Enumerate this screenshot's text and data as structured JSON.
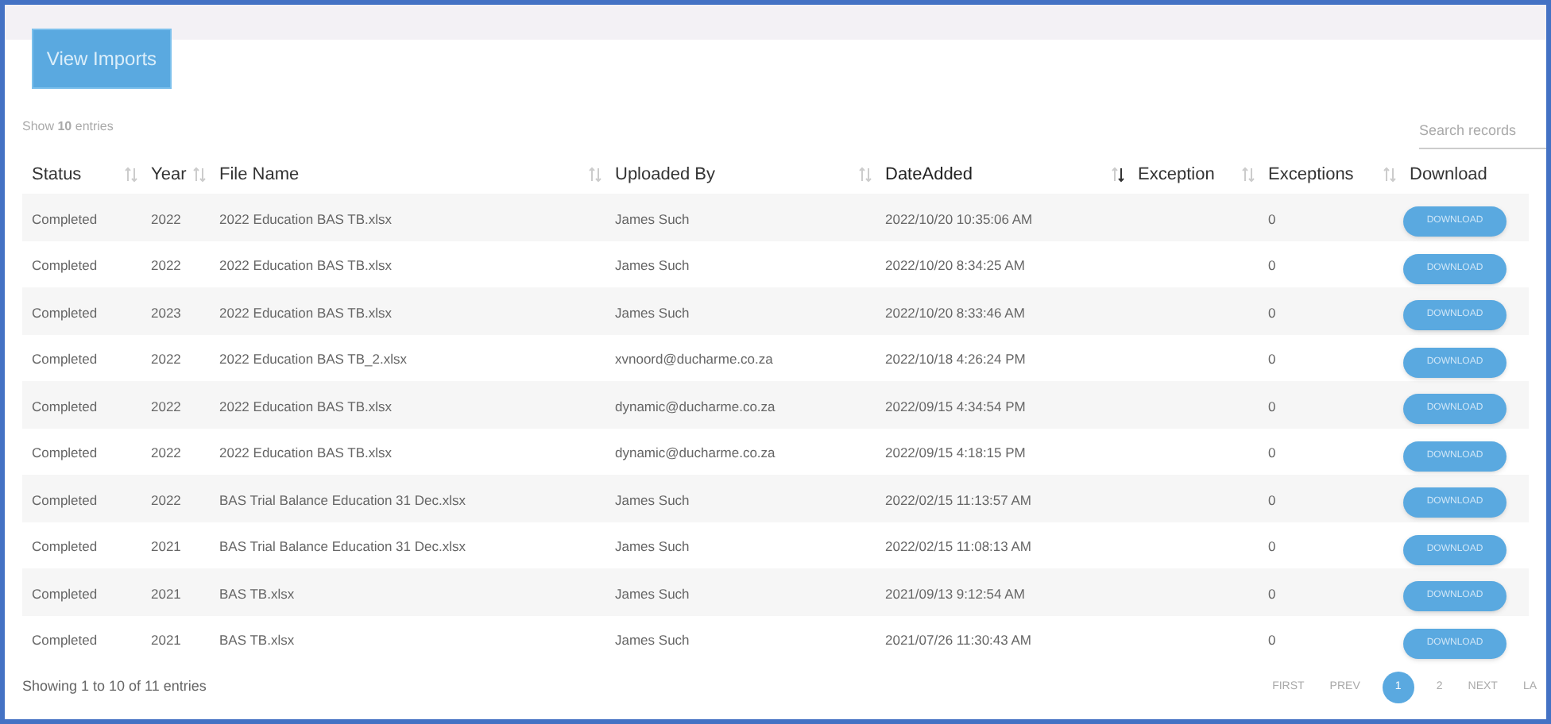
{
  "toolbar": {
    "button": "View Imports"
  },
  "length_info": "Show **10** entries",
  "search": {
    "placeholder": "Search records"
  },
  "table": {
    "columns": [
      {
        "label": "Status",
        "sortable": true,
        "sorted": false
      },
      {
        "label": "Year",
        "sortable": true,
        "sorted": false
      },
      {
        "label": "File Name",
        "sortable": true,
        "sorted": false
      },
      {
        "label": "Uploaded By",
        "sortable": true,
        "sorted": false
      },
      {
        "label": "DateAdded",
        "sortable": true,
        "sorted": true
      },
      {
        "label": "Exception",
        "sortable": true,
        "sorted": false
      },
      {
        "label": "Exceptions",
        "sortable": true,
        "sorted": false
      },
      {
        "label": "Download",
        "sortable": false
      }
    ],
    "rows": [
      {
        "status": "Completed",
        "year": "2022",
        "file": "2022 Education BAS TB.xlsx",
        "by": "James Such",
        "date": "2022/10/20 10:35:06 AM",
        "exceptions": "0",
        "action": "DOWNLOAD"
      },
      {
        "status": "Completed",
        "year": "2022",
        "file": "2022 Education BAS TB.xlsx",
        "by": "James Such",
        "date": "2022/10/20 8:34:25 AM",
        "exceptions": "0",
        "action": "DOWNLOAD"
      },
      {
        "status": "Completed",
        "year": "2023",
        "file": "2022 Education BAS TB.xlsx",
        "by": "James Such",
        "date": "2022/10/20 8:33:46 AM",
        "exceptions": "0",
        "action": "DOWNLOAD"
      },
      {
        "status": "Completed",
        "year": "2022",
        "file": "2022 Education BAS TB_2.xlsx",
        "by": "xvnoord@ducharme.co.za",
        "date": "2022/10/18 4:26:24 PM",
        "exceptions": "0",
        "action": "DOWNLOAD"
      },
      {
        "status": "Completed",
        "year": "2022",
        "file": "2022 Education BAS TB.xlsx",
        "by": "dynamic@ducharme.co.za",
        "date": "2022/09/15 4:34:54 PM",
        "exceptions": "0",
        "action": "DOWNLOAD"
      },
      {
        "status": "Completed",
        "year": "2022",
        "file": "2022 Education BAS TB.xlsx",
        "by": "dynamic@ducharme.co.za",
        "date": "2022/09/15 4:18:15 PM",
        "exceptions": "0",
        "action": "DOWNLOAD"
      },
      {
        "status": "Completed",
        "year": "2022",
        "file": "BAS Trial Balance Education 31 Dec.xlsx",
        "by": "James Such",
        "date": "2022/02/15 11:13:57 AM",
        "exceptions": "0",
        "action": "DOWNLOAD"
      },
      {
        "status": "Completed",
        "year": "2021",
        "file": "BAS Trial Balance Education 31 Dec.xlsx",
        "by": "James Such",
        "date": "2022/02/15 11:08:13 AM",
        "exceptions": "0",
        "action": "DOWNLOAD"
      },
      {
        "status": "Completed",
        "year": "2021",
        "file": "BAS TB.xlsx",
        "by": "James Such",
        "date": "2021/09/13 9:12:54 AM",
        "exceptions": "0",
        "action": "DOWNLOAD"
      },
      {
        "status": "Completed",
        "year": "2021",
        "file": "BAS TB.xlsx",
        "by": "James Such",
        "date": "2021/07/26 11:30:43 AM",
        "exceptions": "0",
        "action": "DOWNLOAD"
      }
    ]
  },
  "footer": {
    "info": "Showing 1 to 10 of 11 entries",
    "pages": [
      {
        "label": "FIRST",
        "selected": false
      },
      {
        "label": "PREV",
        "selected": false
      },
      {
        "label": "1",
        "selected": true
      },
      {
        "label": "2",
        "selected": false
      },
      {
        "label": "NEXT",
        "selected": false
      },
      {
        "label": "LA",
        "selected": false
      }
    ]
  }
}
